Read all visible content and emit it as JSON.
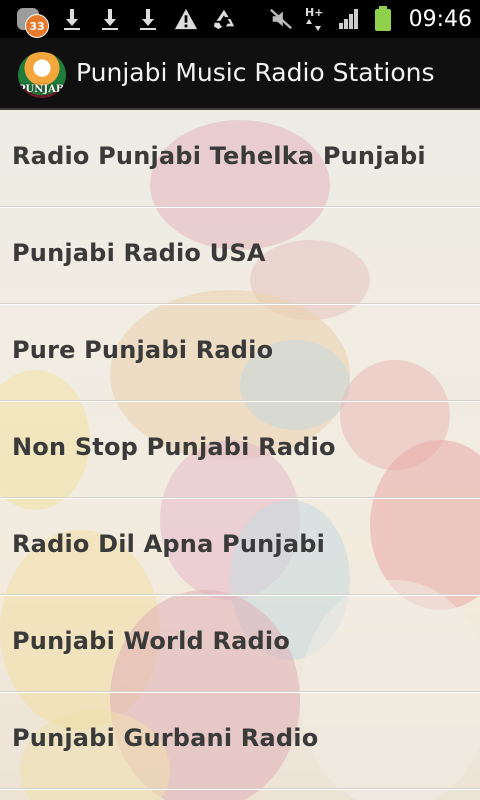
{
  "status_bar": {
    "notification_count": "33",
    "time": "09:46",
    "network": "H+",
    "left_icons": [
      "download-icon",
      "download-icon",
      "download-icon",
      "warning-icon",
      "recycle-icon"
    ],
    "right_icons": [
      "mute-icon",
      "data-arrows-icon",
      "signal-bars-icon",
      "battery-icon"
    ],
    "battery_color": "#8fd14a"
  },
  "header": {
    "title": "Punjabi Music Radio Stations",
    "logo_text": "PUNJABI"
  },
  "stations": [
    {
      "label": "Radio Punjabi Tehelka Punjabi"
    },
    {
      "label": "Punjabi Radio USA"
    },
    {
      "label": "Pure Punjabi Radio"
    },
    {
      "label": "Non Stop Punjabi Radio"
    },
    {
      "label": "Radio Dil Apna Punjabi"
    },
    {
      "label": "Punjabi World Radio"
    },
    {
      "label": "Punjabi Gurbani Radio"
    }
  ]
}
